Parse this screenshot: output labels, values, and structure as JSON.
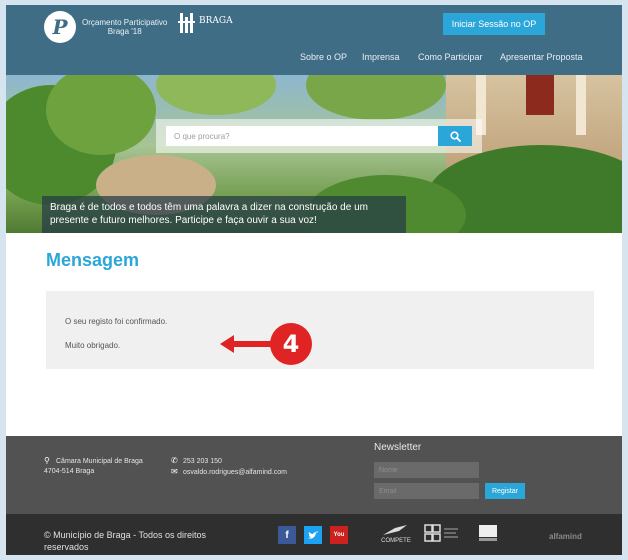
{
  "header": {
    "op_logo_text_line1": "Orçamento Participativo",
    "op_logo_text_line2": "Braga '18",
    "braga_logo_text": "BRAGA",
    "login_button": "Iniciar Sessão no OP",
    "nav": [
      "Sobre o OP",
      "Imprensa",
      "Como Participar",
      "Apresentar Proposta"
    ]
  },
  "hero": {
    "search_placeholder": "O que procura?",
    "caption": "Braga é de todos e todos têm uma palavra a dizer na construção de um presente e futuro melhores. Participe e faça ouvir a sua voz!"
  },
  "main": {
    "title": "Mensagem",
    "message_line1": "O seu registo foi confirmado.",
    "message_line2": "Muito obrigado.",
    "callout_number": "4"
  },
  "footer": {
    "address_line1": "Câmara Municipal de Braga",
    "address_line2": "4704-514 Braga",
    "phone": "253 203 150",
    "email": "osvaldo.rodrigues@alfamind.com",
    "newsletter_title": "Newsletter",
    "name_placeholder": "Nome",
    "email_placeholder": "Email",
    "register_button": "Registar"
  },
  "bottom": {
    "copyright": "© Município de Braga - Todos os direitos reservados",
    "social": [
      "f",
      "t",
      "You"
    ],
    "compete_label": "COMPETE",
    "alfamind": "alfamind"
  },
  "colors": {
    "accent": "#2ba6d9",
    "header": "#3f6d86",
    "footer": "#525252",
    "bottom_bar": "#2f2f2f",
    "callout": "#e02323"
  }
}
